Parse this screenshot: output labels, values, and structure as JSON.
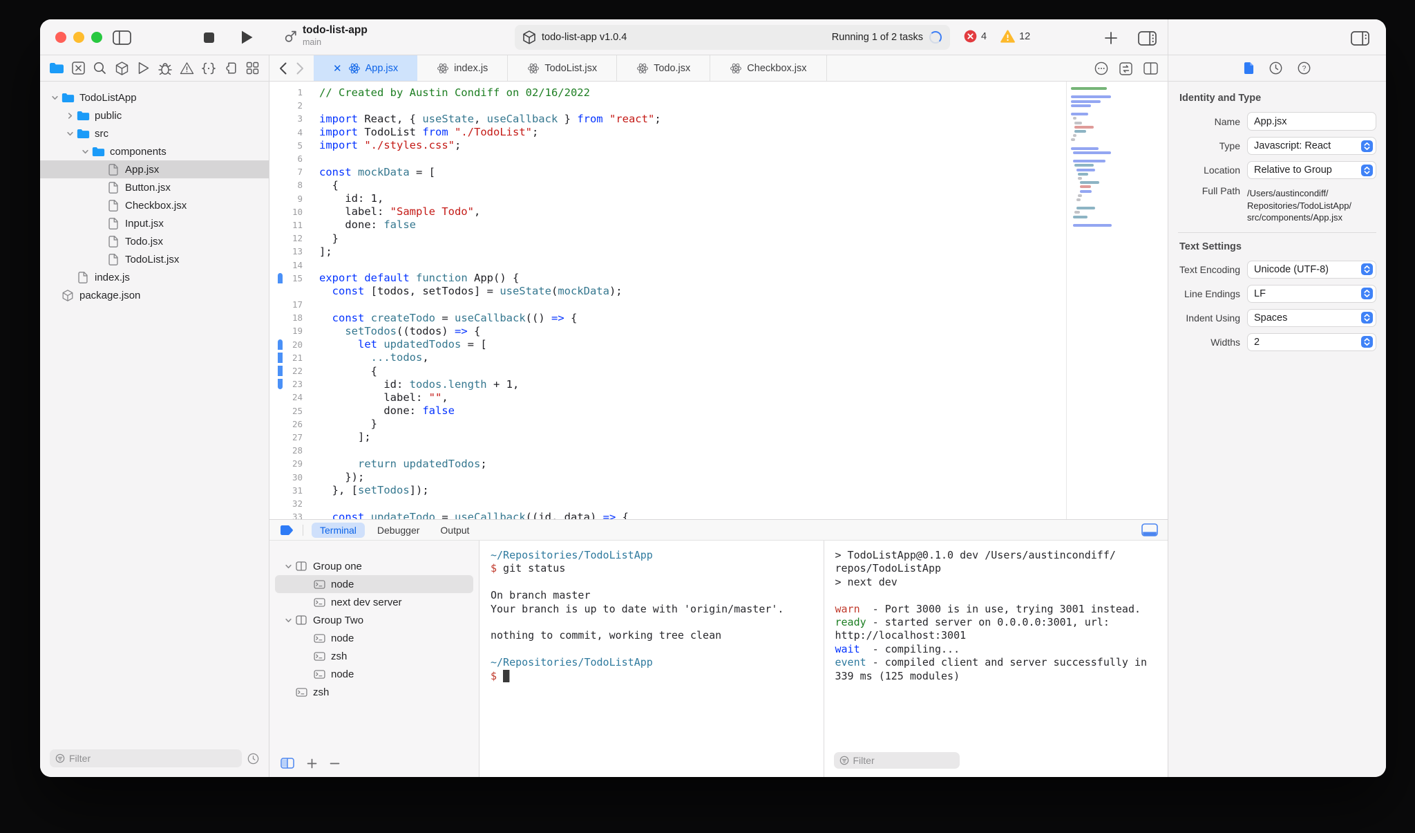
{
  "window": {
    "title": "todo-list-app",
    "subtitle": "main"
  },
  "toolbar": {
    "status": {
      "project": "todo-list-app v1.0.4",
      "running": "Running 1 of 2 tasks"
    },
    "errors": "4",
    "warnings": "12"
  },
  "colors": {
    "accent": "#3478f6",
    "tab_active_bg": "#cfe3fc",
    "tab_active_text": "#0c63e8",
    "error_red": "#e23b3f",
    "warning_yellow": "#fdb92c",
    "code_keyword": "#0433ff",
    "code_string": "#c41a16",
    "code_comment": "#1d7e22",
    "code_teal": "#35778f",
    "terminal_path": "#2f7a9e",
    "terminal_prompt": "#c0392b"
  },
  "navigator": {
    "filter_placeholder": "Filter",
    "tree": [
      {
        "label": "TodoListApp",
        "level": 0,
        "type": "folder",
        "chev": "open"
      },
      {
        "label": "public",
        "level": 1,
        "type": "folder",
        "chev": "closed"
      },
      {
        "label": "src",
        "level": 1,
        "type": "folder",
        "chev": "open"
      },
      {
        "label": "components",
        "level": 2,
        "type": "folder",
        "chev": "open"
      },
      {
        "label": "App.jsx",
        "level": 3,
        "type": "file",
        "selected": true
      },
      {
        "label": "Button.jsx",
        "level": 3,
        "type": "file"
      },
      {
        "label": "Checkbox.jsx",
        "level": 3,
        "type": "file"
      },
      {
        "label": "Input.jsx",
        "level": 3,
        "type": "file"
      },
      {
        "label": "Todo.jsx",
        "level": 3,
        "type": "file"
      },
      {
        "label": "TodoList.jsx",
        "level": 3,
        "type": "file"
      },
      {
        "label": "index.js",
        "level": 1,
        "type": "file"
      },
      {
        "label": "package.json",
        "level": 0,
        "type": "package"
      }
    ]
  },
  "tabs": [
    {
      "label": "App.jsx",
      "active": true
    },
    {
      "label": "index.js"
    },
    {
      "label": "TodoList.jsx"
    },
    {
      "label": "Todo.jsx"
    },
    {
      "label": "Checkbox.jsx"
    }
  ],
  "editor": {
    "lines": [
      {
        "n": "1",
        "t": [
          [
            "cm",
            "// Created by Austin Condiff on 02/16/2022"
          ]
        ]
      },
      {
        "n": "2",
        "t": []
      },
      {
        "n": "3",
        "t": [
          [
            "kw",
            "import"
          ],
          [
            "pl",
            " React, { "
          ],
          [
            "fn",
            "useState"
          ],
          [
            "pl",
            ", "
          ],
          [
            "fn",
            "useCallback"
          ],
          [
            "pl",
            " } "
          ],
          [
            "kw",
            "from"
          ],
          [
            "pl",
            " "
          ],
          [
            "str",
            "\"react\""
          ],
          [
            "pl",
            ";"
          ]
        ]
      },
      {
        "n": "4",
        "t": [
          [
            "kw",
            "import"
          ],
          [
            "pl",
            " TodoList "
          ],
          [
            "kw",
            "from"
          ],
          [
            "pl",
            " "
          ],
          [
            "str",
            "\"./TodoList\""
          ],
          [
            "pl",
            ";"
          ]
        ]
      },
      {
        "n": "5",
        "t": [
          [
            "kw",
            "import"
          ],
          [
            "pl",
            " "
          ],
          [
            "str",
            "\"./styles.css\""
          ],
          [
            "pl",
            ";"
          ]
        ]
      },
      {
        "n": "6",
        "t": []
      },
      {
        "n": "7",
        "t": [
          [
            "kw",
            "const"
          ],
          [
            "pl",
            " "
          ],
          [
            "fn",
            "mockData"
          ],
          [
            "pl",
            " = ["
          ]
        ]
      },
      {
        "n": "8",
        "t": [
          [
            "pl",
            "  {"
          ]
        ]
      },
      {
        "n": "9",
        "t": [
          [
            "pl",
            "    id: 1,"
          ]
        ]
      },
      {
        "n": "10",
        "t": [
          [
            "pl",
            "    label: "
          ],
          [
            "str",
            "\"Sample Todo\""
          ],
          [
            "pl",
            ","
          ]
        ]
      },
      {
        "n": "11",
        "t": [
          [
            "pl",
            "    done: "
          ],
          [
            "fn",
            "false"
          ]
        ]
      },
      {
        "n": "12",
        "t": [
          [
            "pl",
            "  }"
          ]
        ]
      },
      {
        "n": "13",
        "t": [
          [
            "pl",
            "];"
          ]
        ]
      },
      {
        "n": "14",
        "t": []
      },
      {
        "n": "15",
        "bar": "top",
        "t": [
          [
            "kw",
            "export"
          ],
          [
            "pl",
            " "
          ],
          [
            "kw",
            "default"
          ],
          [
            "pl",
            " "
          ],
          [
            "fn",
            "function"
          ],
          [
            "pl",
            " App() {"
          ]
        ]
      },
      {
        "n": "",
        "bar": "bot",
        "t": [
          [
            "pl",
            "  "
          ],
          [
            "kw",
            "const"
          ],
          [
            "pl",
            " [todos, setTodos] = "
          ],
          [
            "fn",
            "useState"
          ],
          [
            "pl",
            "("
          ],
          [
            "fn",
            "mockData"
          ],
          [
            "pl",
            ");"
          ]
        ]
      },
      {
        "n": "17",
        "t": []
      },
      {
        "n": "18",
        "t": [
          [
            "pl",
            "  "
          ],
          [
            "kw",
            "const"
          ],
          [
            "pl",
            " "
          ],
          [
            "fn",
            "createTodo"
          ],
          [
            "pl",
            " = "
          ],
          [
            "fn",
            "useCallback"
          ],
          [
            "pl",
            "(() "
          ],
          [
            "kw",
            "=>"
          ],
          [
            "pl",
            " {"
          ]
        ]
      },
      {
        "n": "19",
        "t": [
          [
            "pl",
            "    "
          ],
          [
            "fn",
            "setTodos"
          ],
          [
            "pl",
            "((todos) "
          ],
          [
            "kw",
            "=>"
          ],
          [
            "pl",
            " {"
          ]
        ]
      },
      {
        "n": "20",
        "bar": "top",
        "t": [
          [
            "pl",
            "      "
          ],
          [
            "kw",
            "let"
          ],
          [
            "pl",
            " "
          ],
          [
            "fn",
            "updatedTodos"
          ],
          [
            "pl",
            " = ["
          ]
        ]
      },
      {
        "n": "21",
        "bar": "mid",
        "t": [
          [
            "pl",
            "        "
          ],
          [
            "fn",
            "...todos"
          ],
          [
            "pl",
            ","
          ]
        ]
      },
      {
        "n": "22",
        "bar": "mid",
        "t": [
          [
            "pl",
            "        {"
          ]
        ]
      },
      {
        "n": "23",
        "bar": "bot",
        "t": [
          [
            "pl",
            "          id: "
          ],
          [
            "fn",
            "todos.length"
          ],
          [
            "pl",
            " + 1,"
          ]
        ]
      },
      {
        "n": "24",
        "t": [
          [
            "pl",
            "          label: "
          ],
          [
            "str",
            "\"\""
          ],
          [
            "pl",
            ","
          ]
        ]
      },
      {
        "n": "25",
        "t": [
          [
            "pl",
            "          done: "
          ],
          [
            "kw",
            "false"
          ]
        ]
      },
      {
        "n": "26",
        "t": [
          [
            "pl",
            "        }"
          ]
        ]
      },
      {
        "n": "27",
        "t": [
          [
            "pl",
            "      ];"
          ]
        ]
      },
      {
        "n": "28",
        "t": []
      },
      {
        "n": "29",
        "t": [
          [
            "pl",
            "      "
          ],
          [
            "fn",
            "return"
          ],
          [
            "pl",
            " "
          ],
          [
            "fn",
            "updatedTodos"
          ],
          [
            "pl",
            ";"
          ]
        ]
      },
      {
        "n": "30",
        "t": [
          [
            "pl",
            "    });"
          ]
        ]
      },
      {
        "n": "31",
        "t": [
          [
            "pl",
            "  }, ["
          ],
          [
            "fn",
            "setTodos"
          ],
          [
            "pl",
            "]);"
          ]
        ]
      },
      {
        "n": "32",
        "t": []
      },
      {
        "n": "33",
        "t": [
          [
            "pl",
            "  "
          ],
          [
            "kw",
            "const"
          ],
          [
            "pl",
            " "
          ],
          [
            "fn",
            "updateTodo"
          ],
          [
            "pl",
            " = "
          ],
          [
            "fn",
            "useCallback"
          ],
          [
            "pl",
            "((id, data) "
          ],
          [
            "kw",
            "=>"
          ],
          [
            "pl",
            " {"
          ]
        ]
      }
    ]
  },
  "bottom_panel": {
    "tabs": [
      {
        "label": "Terminal",
        "active": true
      },
      {
        "label": "Debugger"
      },
      {
        "label": "Output"
      }
    ],
    "filter_placeholder": "Filter",
    "terminal_tree": [
      {
        "label": "Group one",
        "level": 0,
        "type": "group",
        "chev": "open"
      },
      {
        "label": "node",
        "level": 1,
        "type": "term",
        "selected": true
      },
      {
        "label": "next dev server",
        "level": 1,
        "type": "term"
      },
      {
        "label": "Group Two",
        "level": 0,
        "type": "group",
        "chev": "open"
      },
      {
        "label": "node",
        "level": 1,
        "type": "term"
      },
      {
        "label": "zsh",
        "level": 1,
        "type": "term"
      },
      {
        "label": "node",
        "level": 1,
        "type": "term"
      },
      {
        "label": "zsh",
        "level": 0,
        "type": "term"
      }
    ],
    "panes": [
      {
        "lines": [
          [
            [
              "path",
              "~/Repositories/TodoListApp"
            ]
          ],
          [
            [
              "prompt",
              "$"
            ],
            [
              "txt",
              " git status"
            ]
          ],
          [],
          [
            [
              "txt",
              "On branch master"
            ]
          ],
          [
            [
              "txt",
              "Your branch is up to date with 'origin/master'."
            ]
          ],
          [],
          [
            [
              "txt",
              "nothing to commit, working tree clean"
            ]
          ],
          [],
          [
            [
              "path",
              "~/Repositories/TodoListApp"
            ]
          ],
          [
            [
              "prompt",
              "$"
            ],
            [
              "txt",
              " "
            ],
            [
              "cursor",
              "█"
            ]
          ]
        ]
      },
      {
        "lines": [
          [
            [
              "txt",
              "> TodoListApp@0.1.0 dev /Users/austincondiff/"
            ]
          ],
          [
            [
              "txt",
              "repos/TodoListApp"
            ]
          ],
          [
            [
              "txt",
              "> next dev"
            ]
          ],
          [],
          [
            [
              "warn",
              "warn"
            ],
            [
              "txt",
              "  - Port 3000 is in use, trying 3001 instead."
            ]
          ],
          [
            [
              "ready",
              "ready"
            ],
            [
              "txt",
              " - started server on 0.0.0.0:3001, url:"
            ]
          ],
          [
            [
              "txt",
              "http://localhost:3001"
            ]
          ],
          [
            [
              "wait",
              "wait"
            ],
            [
              "txt",
              "  - compiling..."
            ]
          ],
          [
            [
              "event",
              "event"
            ],
            [
              "txt",
              " - compiled client and server successfully in"
            ]
          ],
          [
            [
              "txt",
              "339 ms (125 modules)"
            ]
          ]
        ]
      }
    ]
  },
  "inspector": {
    "sections": [
      {
        "title": "Identity and Type",
        "rows": [
          {
            "label": "Name",
            "type": "input",
            "value": "App.jsx"
          },
          {
            "label": "Type",
            "type": "select",
            "value": "Javascript: React"
          },
          {
            "label": "Location",
            "type": "select",
            "value": "Relative to Group"
          },
          {
            "label": "Full Path",
            "type": "text",
            "value": "/Users/austincondiff/\nRepositories/TodoListApp/\nsrc/components/App.jsx"
          }
        ]
      },
      {
        "title": "Text Settings",
        "rows": [
          {
            "label": "Text Encoding",
            "type": "select",
            "value": "Unicode (UTF-8)"
          },
          {
            "label": "Line Endings",
            "type": "select",
            "value": "LF"
          },
          {
            "label": "Indent Using",
            "type": "select",
            "value": "Spaces"
          },
          {
            "label": "Widths",
            "type": "select",
            "value": "2"
          }
        ]
      }
    ]
  }
}
